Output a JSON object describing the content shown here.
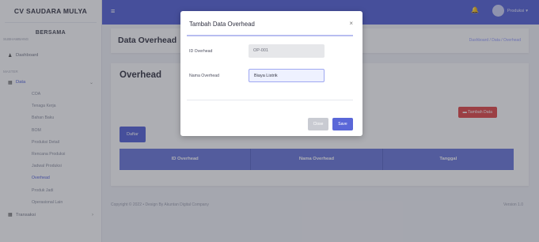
{
  "sidebar": {
    "brand": "CV SAUDARA MULYA",
    "greeting": "BERSAMA",
    "greeting_sub": "SUBHAMBANG",
    "dashboard": "Dashboard",
    "group_label": "MASTER",
    "data_label": "Data",
    "data_items": [
      "COA",
      "Tenaga Kerja",
      "Bahan Baku",
      "BOM",
      "Produksi Detail",
      "Rencana Produksi",
      "Jadwal Produksi",
      "Overhead",
      "Produk Jadi",
      "Operasional Lain"
    ],
    "next_item": "Transaksi"
  },
  "topbar": {
    "user_name": "Produksi"
  },
  "page": {
    "title": "Data Overhead",
    "breadcrumb": "Dashboard / Data / Overhead",
    "card_title": "Overhead",
    "add_button": "Tambah Data",
    "list_button": "Daftar",
    "columns": [
      "ID Overhead",
      "Nama Overhead",
      "Tanggal"
    ]
  },
  "footer": {
    "copyright": "Copyright © 2022 • Design By Akuntan Digital Company",
    "version": "Version 1.0"
  },
  "modal": {
    "title": "Tambah Data Overhead",
    "id_label": "ID Overhead",
    "id_value": "OP-001",
    "name_label": "Nama Overhead",
    "name_value": "Biaya Listrik",
    "close_label": "Close",
    "save_label": "Save"
  }
}
